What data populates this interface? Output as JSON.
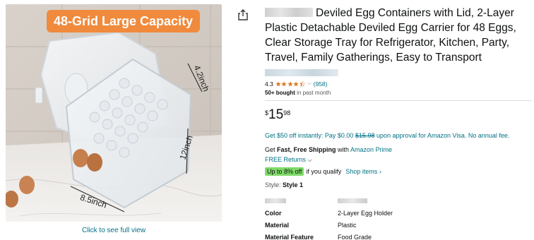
{
  "image": {
    "banner": "48-Grid Large Capacity",
    "dim_width": "8.5inch",
    "dim_length": "12inch",
    "dim_depth": "4.2inch",
    "full_view_link": "Click to see full view"
  },
  "product": {
    "title": "Deviled Egg Containers with Lid, 2-Layer Plastic Detachable Deviled Egg Carrier for 48 Eggs, Clear Storage Tray for Refrigerator, Kitchen, Party, Travel, Family Gatherings, Easy to Transport",
    "rating": "4.3",
    "stars_filled": 4.3,
    "review_count": "(958)",
    "bought_bold": "50+ bought",
    "bought_rest": " in past month"
  },
  "price": {
    "symbol": "$",
    "whole": "15",
    "fraction": "98"
  },
  "offers": {
    "visa_prefix": "Get $50 off instantly: Pay $0.00 ",
    "visa_strike": "$15.98",
    "visa_suffix": " upon approval for Amazon Visa. No annual fee.",
    "ship_prefix": "Get ",
    "ship_bold": "Fast, Free Shipping",
    "ship_mid": " with ",
    "ship_link": "Amazon Prime",
    "returns": "FREE Returns",
    "promo_badge": "Up to 8% off",
    "promo_text": "if you qualify",
    "promo_link": "Shop items ›"
  },
  "style": {
    "label": "Style: ",
    "value": "Style 1"
  },
  "specs": [
    {
      "key": "Color",
      "value": "2-Layer Egg Holder"
    },
    {
      "key": "Material",
      "value": "Plastic"
    },
    {
      "key": "Material Feature",
      "value": "Food Grade"
    }
  ],
  "colors": {
    "link": "#007185",
    "star": "#de7921",
    "badge": "#7fda69",
    "banner": "#f08a3c"
  }
}
